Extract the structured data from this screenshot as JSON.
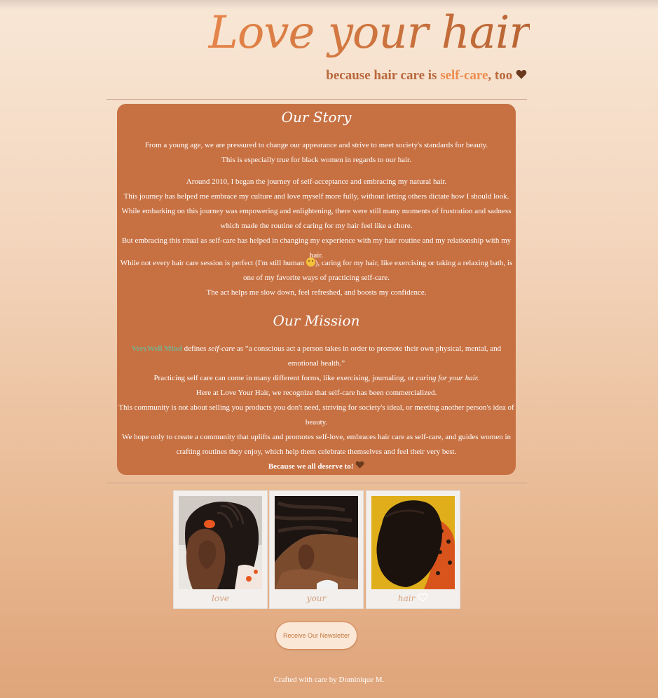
{
  "header": {
    "title": "Love your hair",
    "tagline_prefix": "because hair care is ",
    "tagline_accent": "self-care",
    "tagline_suffix": ", too"
  },
  "story": {
    "title": "Our Story",
    "paragraphs": [
      [
        "From a young age, we are pressured to change our appearance and strive to meet society's standards for beauty.",
        "This is especially true for black women in regards to our hair."
      ],
      [
        "Around 2010, I began the journey of self-acceptance and embracing my natural hair.",
        "This journey has helped me embrace my culture and love myself more fully, without letting others dictate how I should look.",
        "While embarking on this journey was empowering and enlightening, there were still many moments of frustration and sadness which made the routine of caring for my hair feel like a chore.",
        "But embracing this ritual as self-care has helped in changing my experience with my hair routine and my relationship with my hair."
      ],
      [
        "While not every hair care session is perfect (I'm still human ",
        "), caring for my hair, like exercising or taking a relaxing bath, is one of my favorite ways of practicing self-care.",
        "The act helps me slow down, feel refreshed, and boosts my confidence."
      ]
    ]
  },
  "mission": {
    "title": "Our Mission",
    "link_text": "VeryWell Mind",
    "defines": " defines ",
    "term": "self-care",
    "definition": " as “a conscious act a person takes in order to promote their own physical, mental, and emotional health.”",
    "practice_prefix": "Practicing self care can come in many different forms, like exercising, journaling, or ",
    "practice_em": "caring for your hair.",
    "line3": "Here at Love Your Hair, we recognize that self-care has been commercialized.",
    "line4": "This community is not about selling you products you don't need, striving for society's ideal, or meeting another person's idea of beauty.",
    "line5": "We hope only to create a community that uplifts and promotes self-love, embraces hair care as self-care, and guides women in crafting routines they enjoy, which help them celebrate themselves and feel their very best.",
    "closing": "Because we all deserve to!"
  },
  "gallery": {
    "captions": [
      "love",
      "your",
      "hair"
    ]
  },
  "newsletter": {
    "label": "Receive Our Newsletter"
  },
  "footer": {
    "credit": "Crafted with care by Dominique M."
  },
  "colors": {
    "card": "#c77143",
    "title_accent": "#e5854a",
    "link": "#79b08e",
    "heart": "#6b3a1e"
  },
  "icons": [
    "brown-heart-icon",
    "smiling-face-icon",
    "white-heart-icon"
  ]
}
